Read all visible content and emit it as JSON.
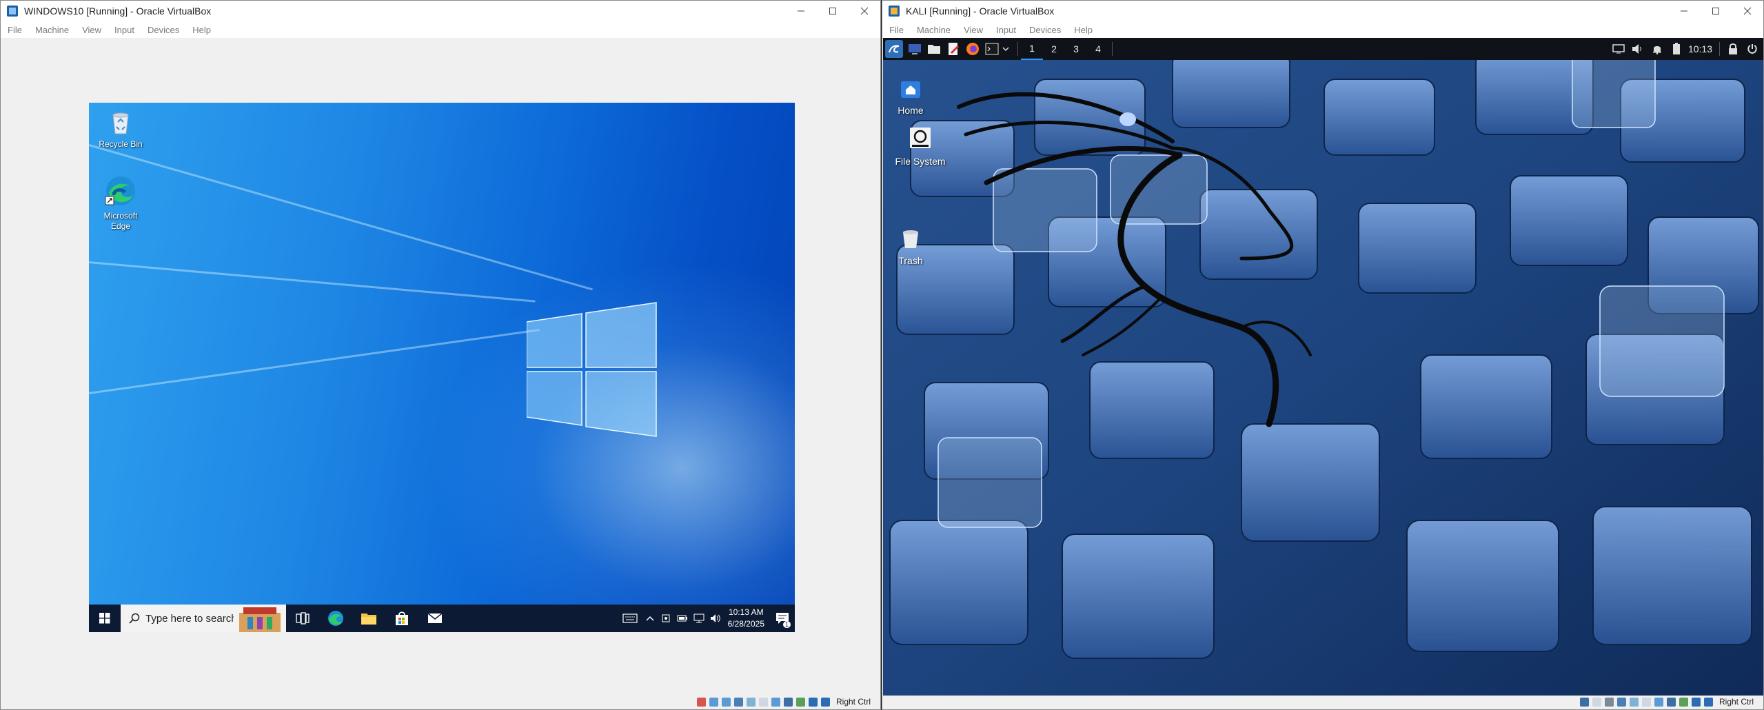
{
  "colors": {
    "win_accent": "#0078d7",
    "kali_accent": "#2f9bff",
    "vbox_frame": "#f0f0f0"
  },
  "windows_vm": {
    "title": "WINDOWS10 [Running] - Oracle VirtualBox",
    "menu": [
      "File",
      "Machine",
      "View",
      "Input",
      "Devices",
      "Help"
    ],
    "desktop_icons": [
      {
        "label": "Recycle Bin",
        "icon": "recycle-bin-icon"
      },
      {
        "label": "Microsoft Edge",
        "icon": "edge-icon"
      }
    ],
    "taskbar": {
      "search_placeholder": "Type here to search",
      "pinned": [
        "task-view-icon",
        "edge-icon",
        "file-explorer-icon",
        "store-icon",
        "mail-icon"
      ],
      "time": "10:13 AM",
      "date": "6/28/2025",
      "notification_count": "1"
    },
    "host_key": "Right Ctrl"
  },
  "kali_vm": {
    "title": "KALI [Running] - Oracle VirtualBox",
    "menu": [
      "File",
      "Machine",
      "View",
      "Input",
      "Devices",
      "Help"
    ],
    "panel": {
      "workspaces": [
        "1",
        "2",
        "3",
        "4"
      ],
      "active_workspace": "1",
      "clock": "10:13"
    },
    "desktop_icons": [
      {
        "label": "Home",
        "icon": "home-folder-icon"
      },
      {
        "label": "File System",
        "icon": "drive-icon"
      },
      {
        "label": "Trash",
        "icon": "trash-icon"
      }
    ],
    "host_key": "Right Ctrl"
  }
}
